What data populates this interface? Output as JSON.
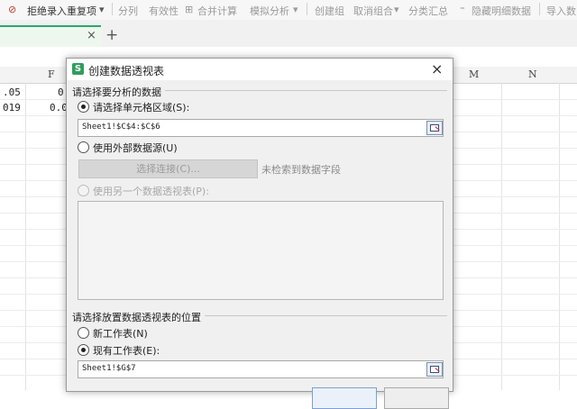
{
  "toolbar": {
    "reject_duplicates": "拒绝录入重复项",
    "split": "分列",
    "validity": "有效性",
    "merge_calc": "合并计算",
    "simulate": "模拟分析",
    "create_group": "创建组",
    "ungroup": "取消组合",
    "subtotal": "分类汇总",
    "hide_details": "隐藏明细数据",
    "import": "导入数"
  },
  "tabs": {
    "close": "×",
    "add": "+"
  },
  "columns": {
    "f": "F",
    "m": "M",
    "n": "N"
  },
  "cells": {
    "r1_left": ".05",
    "r1_f": "0",
    "r2_left": "019",
    "r2_f": "0.0"
  },
  "dialog": {
    "title": "创建数据透视表",
    "close": "×",
    "logo": "S",
    "section_source": "请选择要分析的数据",
    "opt_range": "请选择单元格区域(S):",
    "range_value": "Sheet1!$C$4:$C$6",
    "opt_external": "使用外部数据源(U)",
    "choose_connection": "选择连接(C)...",
    "no_fields": "未检索到数据字段",
    "opt_other_pivot": "使用另一个数据透视表(P):",
    "section_location": "请选择放置数据透视表的位置",
    "opt_new_sheet": "新工作表(N)",
    "opt_existing_sheet": "现有工作表(E):",
    "location_value": "Sheet1!$G$7"
  }
}
